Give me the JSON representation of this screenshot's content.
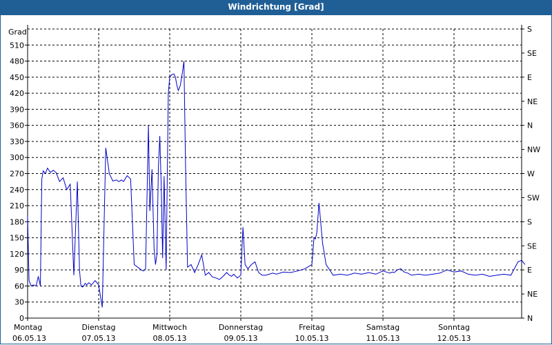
{
  "window": {
    "title": "Windrichtung [Grad]"
  },
  "chart_data": {
    "type": "line",
    "title": "Windrichtung [Grad]",
    "ylabel": "Grad",
    "ylim": [
      0,
      540
    ],
    "yticks": [
      0,
      30,
      60,
      90,
      120,
      150,
      180,
      210,
      240,
      270,
      300,
      330,
      360,
      390,
      420,
      450,
      480,
      510
    ],
    "right_axis_labels": [
      "N",
      "NE",
      "E",
      "SE",
      "S",
      "SW",
      "W",
      "NW",
      "N",
      "NE",
      "E",
      "SE",
      "S"
    ],
    "grid": true,
    "x_days": [
      {
        "day": "Montag",
        "date": "06.05.13"
      },
      {
        "day": "Dienstag",
        "date": "07.05.13"
      },
      {
        "day": "Mittwoch",
        "date": "08.05.13"
      },
      {
        "day": "Donnerstag",
        "date": "09.05.13"
      },
      {
        "day": "Freitag",
        "date": "10.05.13"
      },
      {
        "day": "Samstag",
        "date": "11.05.13"
      },
      {
        "day": "Sonntag",
        "date": "12.05.13"
      }
    ],
    "series": [
      {
        "color": "#0000c8",
        "x": [
          0,
          0.02,
          0.05,
          0.08,
          0.12,
          0.15,
          0.18,
          0.2,
          0.22,
          0.25,
          0.28,
          0.32,
          0.36,
          0.4,
          0.45,
          0.5,
          0.55,
          0.6,
          0.65,
          0.7,
          0.73,
          0.75,
          0.77,
          0.79,
          0.81,
          0.83,
          0.86,
          0.9,
          0.95,
          1.0,
          1.05,
          1.1,
          1.15,
          1.2,
          1.25,
          1.28,
          1.3,
          1.32,
          1.35,
          1.4,
          1.45,
          1.5,
          1.55,
          1.6,
          1.63,
          1.66,
          1.7,
          1.72,
          1.75,
          1.78,
          1.8,
          1.82,
          1.84,
          1.86,
          1.88,
          1.9,
          1.92,
          1.95,
          1.98,
          2.0,
          2.03,
          2.06,
          2.08,
          2.1,
          2.12,
          2.15,
          2.18,
          2.2,
          2.22,
          2.25,
          2.3,
          2.35,
          2.4,
          2.45,
          2.5,
          2.55,
          2.6,
          2.65,
          2.7,
          2.75,
          2.8,
          2.84,
          2.87,
          2.9,
          2.95,
          3.0,
          3.03,
          3.06,
          3.1,
          3.15,
          3.2,
          3.25,
          3.3,
          3.35,
          3.4,
          3.45,
          3.5,
          3.6,
          3.7,
          3.8,
          3.9,
          4.0,
          4.03,
          4.05,
          4.07,
          4.1,
          4.15,
          4.2,
          4.3,
          4.4,
          4.5,
          4.6,
          4.7,
          4.8,
          4.9,
          5.0,
          5.05,
          5.1,
          5.13,
          5.16,
          5.2,
          5.25,
          5.3,
          5.35,
          5.4,
          5.5,
          5.6,
          5.7,
          5.8,
          5.9,
          6.0,
          6.1,
          6.2,
          6.3,
          6.4,
          6.5,
          6.6,
          6.7,
          6.8,
          6.9,
          6.95,
          7.0
        ],
        "y": [
          190,
          70,
          60,
          62,
          60,
          78,
          60,
          260,
          275,
          270,
          280,
          272,
          276,
          272,
          255,
          262,
          240,
          250,
          80,
          255,
          90,
          60,
          58,
          60,
          65,
          62,
          66,
          62,
          70,
          62,
          20,
          318,
          270,
          256,
          258,
          255,
          256,
          258,
          255,
          266,
          260,
          100,
          95,
          90,
          88,
          92,
          360,
          200,
          278,
          130,
          100,
          120,
          280,
          340,
          250,
          112,
          265,
          90,
          420,
          450,
          455,
          456,
          450,
          435,
          425,
          435,
          460,
          480,
          300,
          95,
          100,
          85,
          100,
          118,
          80,
          85,
          77,
          75,
          72,
          78,
          85,
          80,
          78,
          82,
          75,
          80,
          170,
          100,
          92,
          100,
          105,
          85,
          80,
          80,
          82,
          84,
          82,
          86,
          85,
          88,
          92,
          100,
          150,
          148,
          160,
          215,
          140,
          100,
          80,
          82,
          80,
          84,
          82,
          85,
          82,
          88,
          86,
          84,
          86,
          85,
          90,
          92,
          86,
          84,
          80,
          82,
          80,
          82,
          84,
          90,
          86,
          88,
          82,
          80,
          82,
          78,
          80,
          82,
          80,
          105,
          108,
          100
        ]
      }
    ]
  }
}
